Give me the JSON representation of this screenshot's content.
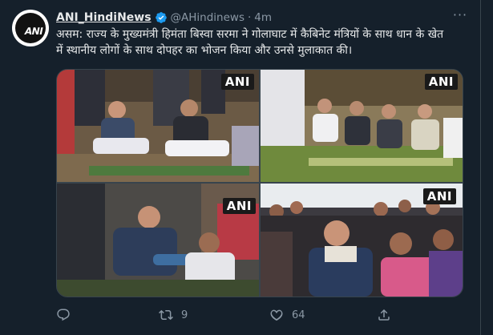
{
  "tweet": {
    "author_name": "ANI_HindiNews",
    "handle": "@AHindinews",
    "separator": "·",
    "time": "4m",
    "more_glyph": "···",
    "text": "असम: राज्य के मुख्यमंत्री हिमंता बिस्वा सरमा ने गोलाघाट में कैबिनेट मंत्रियों के साथ धान के खेत में स्थानीय लोगों के साथ दोपहर का भोजन किया और उनसे मुलाकात की।"
  },
  "media": {
    "watermark": "ANI",
    "images": [
      {
        "subject": "photo-leaders-seated-on-field"
      },
      {
        "subject": "photo-group-eating-in-paddy-field"
      },
      {
        "subject": "photo-cm-greeting-elderly-man"
      },
      {
        "subject": "photo-cm-with-crowd"
      }
    ]
  },
  "actions": {
    "reply_count": "",
    "retweet_count": "9",
    "like_count": "64"
  },
  "colors": {
    "background": "#15202b",
    "text": "#e7e9ea",
    "secondary": "#8b98a5",
    "border": "#38444d",
    "verified": "#1d9bf0"
  },
  "icons": [
    "ani-avatar-logo",
    "verified-badge-icon",
    "more-icon",
    "reply-icon",
    "retweet-icon",
    "like-icon"
  ]
}
